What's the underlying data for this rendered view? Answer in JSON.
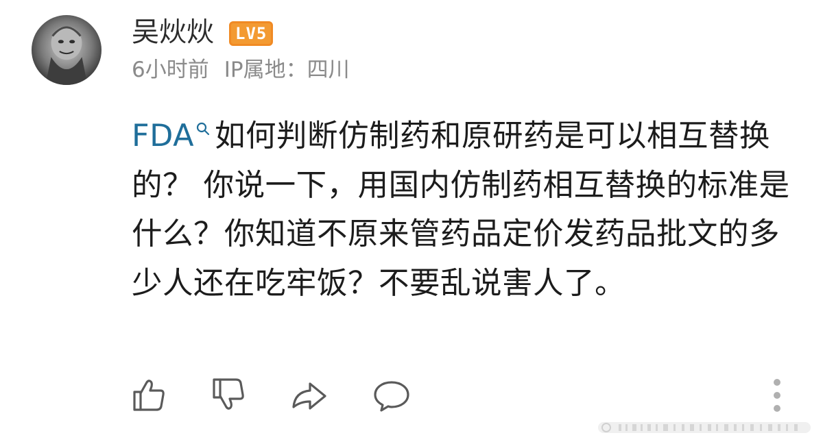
{
  "post": {
    "username": "吴炏炏",
    "level_badge": "LV5",
    "time": "6小时前",
    "ip_location": "IP属地：四川",
    "topic": "FDA",
    "body": "如何判断仿制药和原研药是可以相互替换的？ 你说一下，用国内仿制药相互替换的标准是什么？你知道不原来管药品定价发药品批文的多少人还在吃牢饭？不要乱说害人了。"
  },
  "actions": {
    "like_icon": "thumbs-up-icon",
    "dislike_icon": "thumbs-down-icon",
    "share_icon": "share-arrow-icon",
    "comment_icon": "speech-bubble-icon",
    "more_icon": "vertical-ellipsis-icon"
  },
  "colors": {
    "username": "#2b2b2b",
    "meta": "#8a8a8a",
    "topic_link": "#1f6e9a",
    "badge": "#f39a32",
    "icon_stroke": "#5a5a5a"
  }
}
